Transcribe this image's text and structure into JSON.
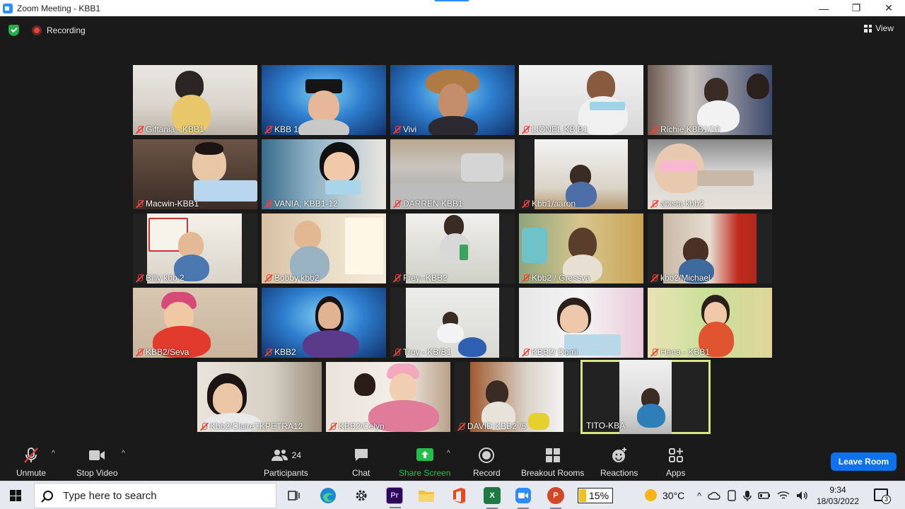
{
  "window": {
    "title": "Zoom Meeting - KBB1",
    "min": "—",
    "restore": "❐",
    "close": "✕"
  },
  "topbar": {
    "recording_label": "Recording",
    "view_label": "View"
  },
  "participants": [
    {
      "name": "Giftania - KBB1"
    },
    {
      "name": "KBB 1"
    },
    {
      "name": "Vivi"
    },
    {
      "name": "LIONEL KB B1"
    },
    {
      "name": "Richie KBB1/10"
    },
    {
      "name": "Macwin-KBB1"
    },
    {
      "name": "VANIA, KBB1-12"
    },
    {
      "name": "DARREN KBB1"
    },
    {
      "name": "Kbb1/aaron"
    },
    {
      "name": "abista kbb2"
    },
    {
      "name": "Billy kbb 2"
    },
    {
      "name": "Bobby kbb2"
    },
    {
      "name": "Frey--KBB2"
    },
    {
      "name": "Kbb2 / Gressya"
    },
    {
      "name": "kbb2/Michael"
    },
    {
      "name": "KBB2/Seva"
    },
    {
      "name": "KBB2"
    },
    {
      "name": "Troy - KB/B1"
    },
    {
      "name": "KBB2/ Domi"
    },
    {
      "name": "Hana - KBB1"
    },
    {
      "name": "Kbb2/ClaireTKPETRA12"
    },
    {
      "name": "KBB2\\Celyn"
    },
    {
      "name": "DAVID KBB2 /5"
    },
    {
      "name": "TITO-KBA"
    }
  ],
  "toolbar": {
    "unmute": "Unmute",
    "stop_video": "Stop Video",
    "participants_label": "Participants",
    "participants_count": "24",
    "chat": "Chat",
    "share_screen": "Share Screen",
    "record": "Record",
    "breakout_rooms": "Breakout Rooms",
    "reactions": "Reactions",
    "apps": "Apps",
    "leave_room": "Leave Room",
    "caret": "^"
  },
  "taskbar": {
    "search_placeholder": "Type here to search",
    "battery_percent": "15%",
    "temperature": "30°C",
    "time": "9:34",
    "date": "18/03/2022",
    "notifications_count": "3",
    "premiere_label": "Pr",
    "excel_label": "X",
    "powerpoint_label": "P",
    "tray_chevron": "^"
  },
  "colors": {
    "accent": "#0e72ed",
    "active_speaker": "#d6e685",
    "share_green": "#21c04c",
    "mute_red": "#e8443a"
  }
}
